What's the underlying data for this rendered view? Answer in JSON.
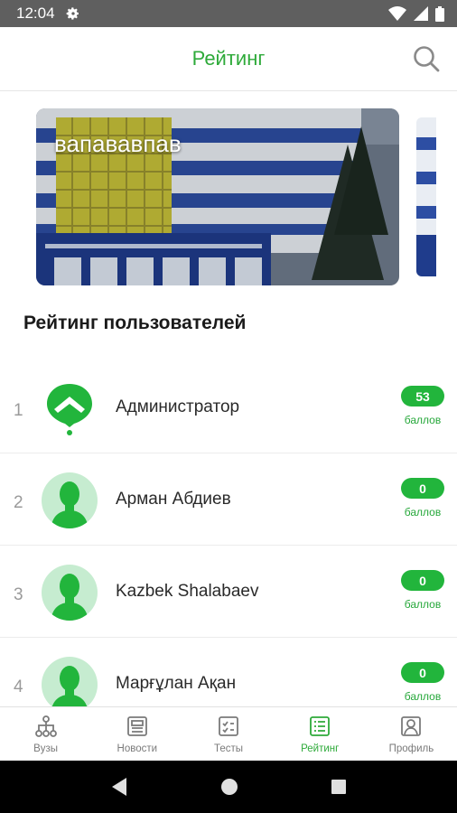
{
  "status_bar": {
    "time": "12:04"
  },
  "app_bar": {
    "title": "Рейтинг"
  },
  "banner": {
    "title": "вапававпав"
  },
  "section": {
    "title": "Рейтинг пользователей"
  },
  "ratings": [
    {
      "rank": "1",
      "name": "Администратор",
      "points": "53",
      "points_label": "баллов",
      "avatar": "app-logo-icon"
    },
    {
      "rank": "2",
      "name": "Арман Абдиев",
      "points": "0",
      "points_label": "баллов",
      "avatar": "user-silhouette-icon"
    },
    {
      "rank": "3",
      "name": "Kazbek Shalabaev",
      "points": "0",
      "points_label": "баллов",
      "avatar": "user-silhouette-icon"
    },
    {
      "rank": "4",
      "name": "Марғұлан Ақан",
      "points": "0",
      "points_label": "баллов",
      "avatar": "user-silhouette-icon"
    }
  ],
  "bottom_nav": [
    {
      "label": "Вузы",
      "icon": "network-icon",
      "active": false
    },
    {
      "label": "Новости",
      "icon": "news-icon",
      "active": false
    },
    {
      "label": "Тесты",
      "icon": "checklist-icon",
      "active": false
    },
    {
      "label": "Рейтинг",
      "icon": "list-icon",
      "active": true
    },
    {
      "label": "Профиль",
      "icon": "profile-icon",
      "active": false
    }
  ],
  "colors": {
    "accent": "#2eaa3a",
    "pill": "#22b53c",
    "avatar_bg": "#c6ecd0",
    "status_bar": "#5f5f5f"
  }
}
